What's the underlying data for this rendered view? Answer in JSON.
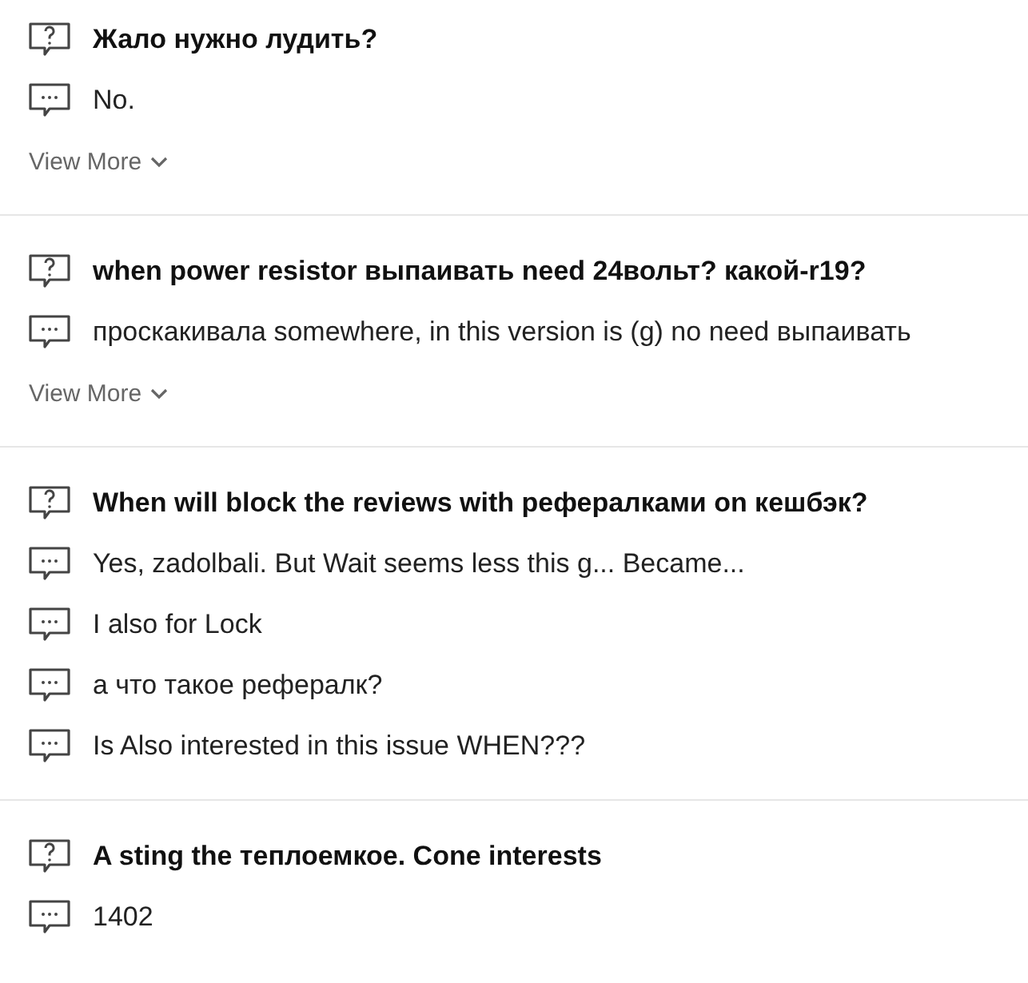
{
  "questions": [
    {
      "question": "Жало нужно лудить?",
      "answers": [
        "No."
      ],
      "view_more": "View More"
    },
    {
      "question": "when power resistor выпаивать need 24вольт? какой-r19?",
      "answers": [
        "проскакивала somewhere, in this version is (g) no need выпаивать"
      ],
      "view_more": "View More"
    },
    {
      "question": "When will block the reviews with рефералками on кешбэк?",
      "answers": [
        "Yes, zadolbali. But Wait seems less this g... Became...",
        "I also for Lock",
        "а что такое рефералк?",
        "Is Also interested in this issue WHEN???"
      ]
    },
    {
      "question": "A sting the теплоемкое. Cone interests",
      "answers": [
        "1402"
      ]
    }
  ]
}
